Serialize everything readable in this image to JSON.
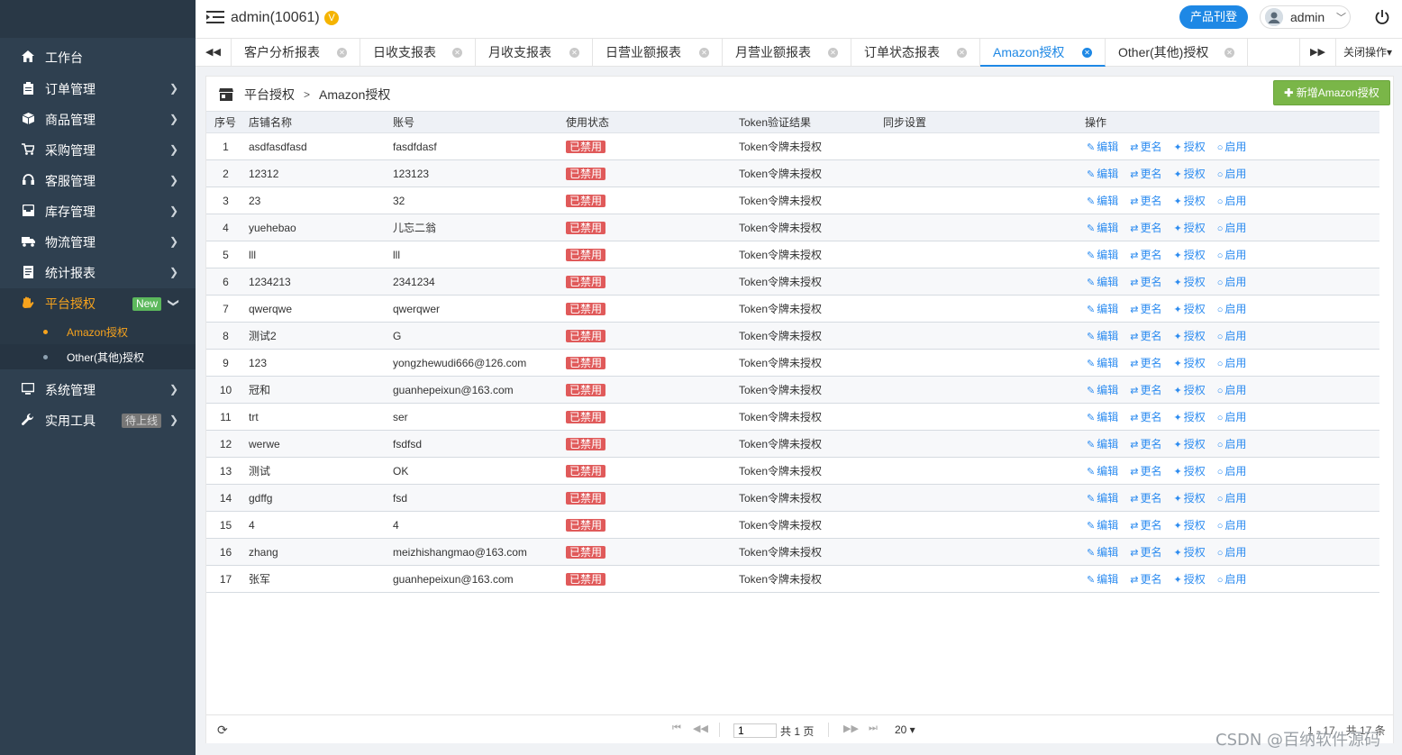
{
  "sidebar": {
    "items": [
      {
        "label": "工作台",
        "icon": "home-icon"
      },
      {
        "label": "订单管理",
        "icon": "clipboard-icon"
      },
      {
        "label": "商品管理",
        "icon": "cube-icon"
      },
      {
        "label": "采购管理",
        "icon": "cart-icon"
      },
      {
        "label": "客服管理",
        "icon": "headphones-icon"
      },
      {
        "label": "库存管理",
        "icon": "inbox-icon"
      },
      {
        "label": "物流管理",
        "icon": "truck-icon"
      },
      {
        "label": "统计报表",
        "icon": "document-icon"
      },
      {
        "label": "平台授权",
        "icon": "hand-icon",
        "badge": "New"
      },
      {
        "label": "系统管理",
        "icon": "monitor-icon"
      },
      {
        "label": "实用工具",
        "icon": "wrench-icon",
        "badge": "待上线"
      }
    ],
    "sub_items": [
      {
        "label": "Amazon授权"
      },
      {
        "label": "Other(其他)授权"
      }
    ]
  },
  "header": {
    "title": "admin(10061)",
    "vip_badge": "V",
    "product_button": "产品刊登",
    "user_name": "admin"
  },
  "tabs": [
    {
      "label": "客户分析报表"
    },
    {
      "label": "日收支报表"
    },
    {
      "label": "月收支报表"
    },
    {
      "label": "日营业额报表"
    },
    {
      "label": "月营业额报表"
    },
    {
      "label": "订单状态报表"
    },
    {
      "label": "Amazon授权"
    },
    {
      "label": "Other(其他)授权"
    }
  ],
  "close_ops_label": "关闭操作▾",
  "breadcrumb": {
    "root": "平台授权",
    "sep": ">",
    "current": "Amazon授权"
  },
  "add_button": "新增Amazon授权",
  "table": {
    "columns": [
      "序号",
      "店铺名称",
      "账号",
      "使用状态",
      "Token验证结果",
      "同步设置",
      "操作"
    ],
    "rows": [
      {
        "no": "1",
        "shop": "asdfasdfasd",
        "account": "fasdfdasf",
        "status": "已禁用",
        "token": "Token令牌未授权"
      },
      {
        "no": "2",
        "shop": "12312",
        "account": "123123",
        "status": "已禁用",
        "token": "Token令牌未授权"
      },
      {
        "no": "3",
        "shop": "23",
        "account": "32",
        "status": "已禁用",
        "token": "Token令牌未授权"
      },
      {
        "no": "4",
        "shop": "yuehebao",
        "account": "儿忘二翁",
        "status": "已禁用",
        "token": "Token令牌未授权"
      },
      {
        "no": "5",
        "shop": "lll",
        "account": "lll",
        "status": "已禁用",
        "token": "Token令牌未授权"
      },
      {
        "no": "6",
        "shop": "1234213",
        "account": "2341234",
        "status": "已禁用",
        "token": "Token令牌未授权"
      },
      {
        "no": "7",
        "shop": "qwerqwe",
        "account": "qwerqwer",
        "status": "已禁用",
        "token": "Token令牌未授权"
      },
      {
        "no": "8",
        "shop": "测试2",
        "account": "G",
        "status": "已禁用",
        "token": "Token令牌未授权"
      },
      {
        "no": "9",
        "shop": "123",
        "account": "yongzhewudi666@126.com",
        "status": "已禁用",
        "token": "Token令牌未授权"
      },
      {
        "no": "10",
        "shop": "冠和",
        "account": "guanhepeixun@163.com",
        "status": "已禁用",
        "token": "Token令牌未授权"
      },
      {
        "no": "11",
        "shop": "trt",
        "account": "ser",
        "status": "已禁用",
        "token": "Token令牌未授权"
      },
      {
        "no": "12",
        "shop": "werwe",
        "account": "fsdfsd",
        "status": "已禁用",
        "token": "Token令牌未授权"
      },
      {
        "no": "13",
        "shop": "测试",
        "account": "OK",
        "status": "已禁用",
        "token": "Token令牌未授权"
      },
      {
        "no": "14",
        "shop": "gdffg",
        "account": "fsd",
        "status": "已禁用",
        "token": "Token令牌未授权"
      },
      {
        "no": "15",
        "shop": "4",
        "account": "4",
        "status": "已禁用",
        "token": "Token令牌未授权"
      },
      {
        "no": "16",
        "shop": "zhang",
        "account": "meizhishangmao@163.com",
        "status": "已禁用",
        "token": "Token令牌未授权"
      },
      {
        "no": "17",
        "shop": "张军",
        "account": "guanhepeixun@163.com",
        "status": "已禁用",
        "token": "Token令牌未授权"
      }
    ],
    "actions": [
      "编辑",
      "更名",
      "授权",
      "启用"
    ]
  },
  "pager": {
    "page": "1",
    "total_pages": "共 1 页",
    "page_size": "20 ▾",
    "info": "1 - 17　共 17 条"
  },
  "watermark": "CSDN @百纳软件源码",
  "colors": {
    "sidebar_bg": "#2f4050",
    "accent": "#f7a31d",
    "link": "#2d8cf0",
    "status_disabled": "#e05a5a",
    "add_button": "#7ab648"
  }
}
